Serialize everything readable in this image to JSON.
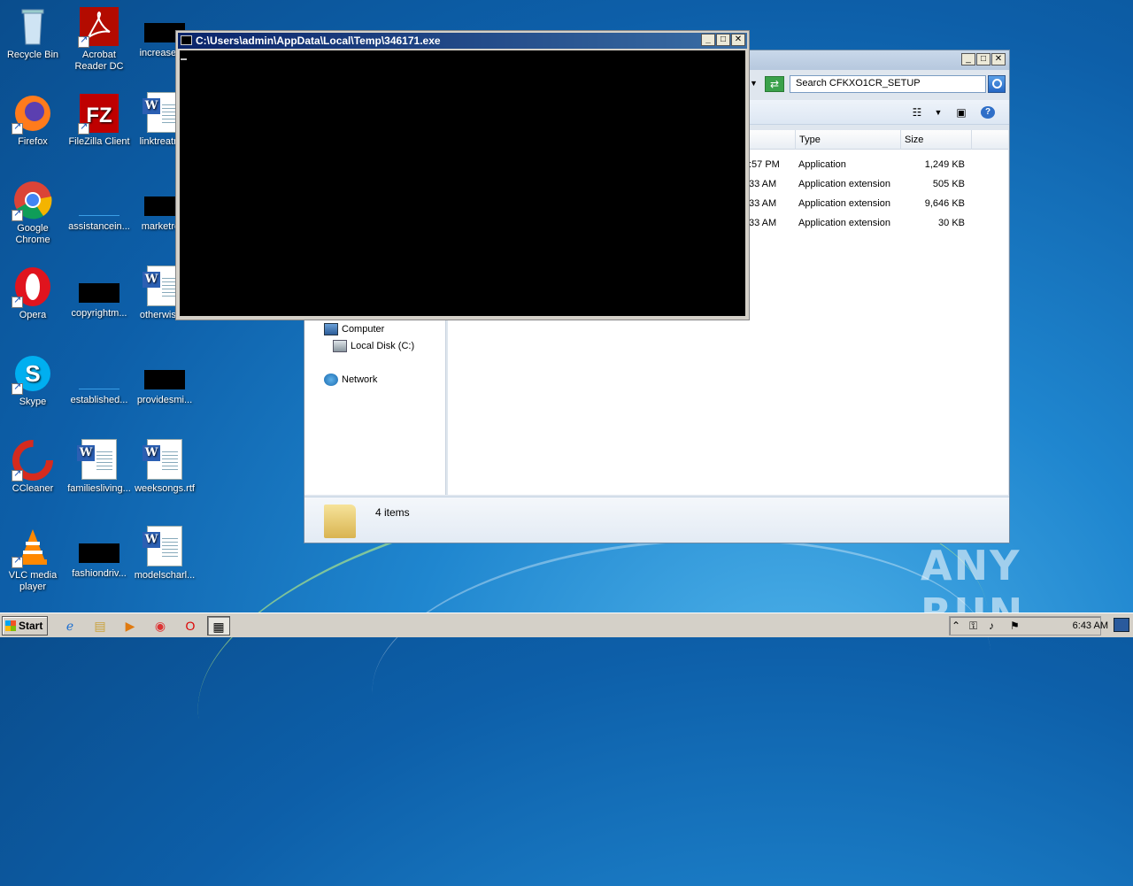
{
  "desktop": {
    "icons": [
      {
        "label": "Recycle Bin"
      },
      {
        "label": "Acrobat Reader DC"
      },
      {
        "label": "increased..."
      },
      {
        "label": "Firefox"
      },
      {
        "label": "FileZilla Client"
      },
      {
        "label": "linktreatm..."
      },
      {
        "label": "Google Chrome"
      },
      {
        "label": "assistancein..."
      },
      {
        "label": "marketre..."
      },
      {
        "label": "Opera"
      },
      {
        "label": "copyrightm..."
      },
      {
        "label": "otherwise..."
      },
      {
        "label": "Skype"
      },
      {
        "label": "established..."
      },
      {
        "label": "providesmi..."
      },
      {
        "label": "CCleaner"
      },
      {
        "label": "familiesliving..."
      },
      {
        "label": "weeksongs.rtf"
      },
      {
        "label": "VLC media player"
      },
      {
        "label": "fashiondriv..."
      },
      {
        "label": "modelscharl..."
      }
    ]
  },
  "console": {
    "title": "C:\\Users\\admin\\AppData\\Local\\Temp\\346171.exe"
  },
  "explorer": {
    "search_placeholder": "Search CFKXO1CR_SETUP",
    "columns": {
      "type": "Type",
      "size": "Size"
    },
    "rows": [
      {
        "modified": ":57 PM",
        "type": "Application",
        "size": "1,249 KB"
      },
      {
        "modified": "33 AM",
        "type": "Application extension",
        "size": "505 KB"
      },
      {
        "modified": "33 AM",
        "type": "Application extension",
        "size": "9,646 KB"
      },
      {
        "modified": "33 AM",
        "type": "Application extension",
        "size": "30 KB"
      }
    ],
    "nav": {
      "computer": "Computer",
      "local_disk": "Local Disk (C:)",
      "network": "Network"
    },
    "status": "4 items"
  },
  "taskbar": {
    "start_label": "Start",
    "clock": "6:43 AM"
  },
  "watermark": "ANY RUN"
}
